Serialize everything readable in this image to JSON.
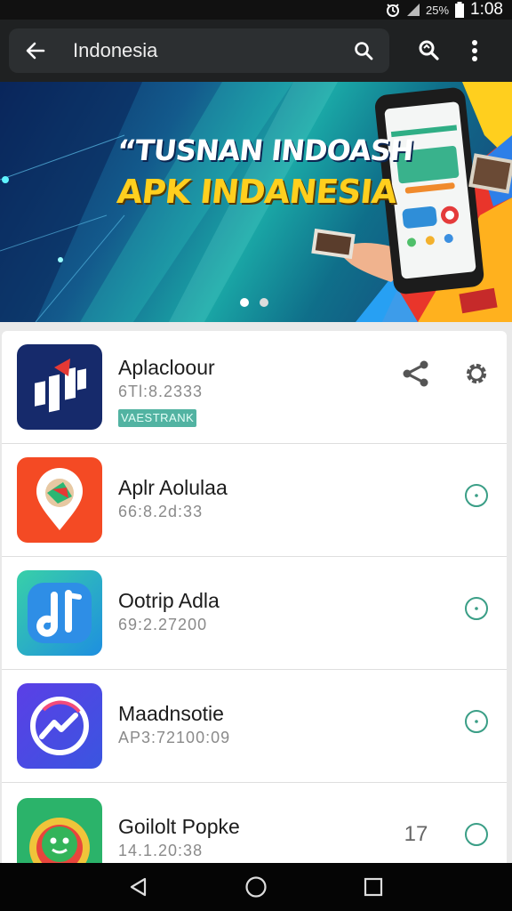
{
  "status_bar": {
    "battery_text": "25%",
    "time": "1:08",
    "icons": [
      "alarm-icon",
      "signal-icon",
      "battery-icon"
    ]
  },
  "search_bar": {
    "query": "Indonesia",
    "back_icon": "arrow-left-icon",
    "search_icon": "search-icon",
    "actions": [
      "voice-search-icon",
      "more-vertical-icon"
    ]
  },
  "banner": {
    "headline": "“TUSNAN INDOASH",
    "subheadline": "APK INDANESIA",
    "page_count": 2,
    "active_page": 1,
    "colors": {
      "headline": "#ffffff",
      "subheadline": "#ffcf1e"
    }
  },
  "apps": [
    {
      "name": "Aplacloour",
      "meta": "6Tl:8.2333",
      "badge": "VAESTRANK",
      "icon": "red-white-bars-app-icon",
      "actions": [
        "share-icon",
        "settings-gear-icon"
      ]
    },
    {
      "name": "Aplr Aolulaa",
      "meta": "66:8.2d:33",
      "icon": "map-pin-app-icon",
      "actions": [
        "radio-icon"
      ]
    },
    {
      "name": "Ootrip Adla",
      "meta": "69:2.27200",
      "icon": "music-note-app-icon",
      "actions": [
        "radio-icon"
      ]
    },
    {
      "name": "Maadnsotie",
      "meta": "AP3:72100:09",
      "icon": "messenger-app-icon",
      "actions": [
        "radio-icon"
      ]
    },
    {
      "name": "Goilolt Popke",
      "meta": "14.1.20:38",
      "tag": "17",
      "icon": "green-face-app-icon",
      "actions": [
        "radio-icon"
      ]
    }
  ],
  "accent_color": "#3a9e86",
  "nav_bar": [
    "back-triangle-icon",
    "home-circle-icon",
    "recents-square-icon"
  ]
}
